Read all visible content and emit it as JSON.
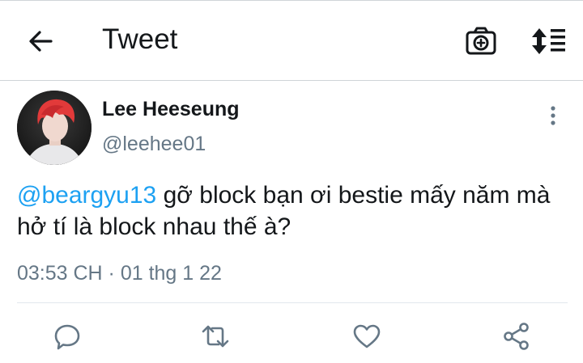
{
  "header": {
    "title": "Tweet",
    "icons": {
      "back": "arrow-left-icon",
      "camera": "camera-plus-icon",
      "sort": "sort-icon"
    }
  },
  "tweet": {
    "author": {
      "display_name": "Lee Heeseung",
      "username": "@leehee01"
    },
    "text": {
      "mention": "@beargyu13",
      "body": " gỡ block bạn ơi bestie mấy năm mà hở tí là block nhau thế à?"
    },
    "timestamp": "03:53 CH · 01 thg 1 22",
    "actions": [
      "reply",
      "retweet",
      "like",
      "share"
    ]
  },
  "colors": {
    "text": "#14171a",
    "muted": "#657786",
    "link": "#1da1f2",
    "divider": "#e1e8ed",
    "icon": "#657786"
  }
}
